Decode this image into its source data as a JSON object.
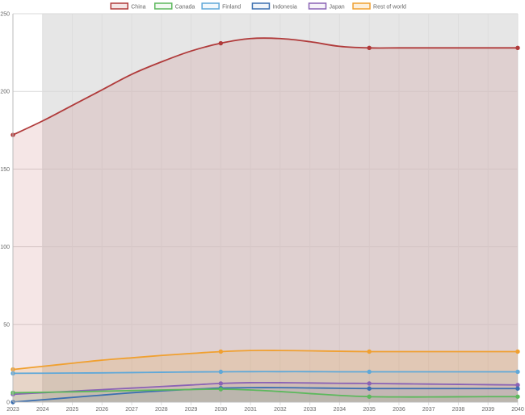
{
  "chart_data": {
    "type": "area",
    "title": "",
    "xlabel": "",
    "ylabel": "",
    "x": [
      "2023",
      "2024",
      "2025",
      "2026",
      "2027",
      "2028",
      "2029",
      "2030",
      "2031",
      "2032",
      "2033",
      "2034",
      "2035",
      "2036",
      "2037",
      "2038",
      "2039",
      "2040"
    ],
    "ylim": [
      0,
      250
    ],
    "y_ticks": [
      "0",
      "50",
      "100",
      "150",
      "200",
      "250"
    ],
    "grid": true,
    "legend_position": "top-center",
    "shaded_start_year": "2024",
    "series": [
      {
        "name": "China",
        "color": "#b03a3a",
        "fill": "rgba(176,58,58,0.13)",
        "anchor_x": [
          "2023",
          "2030",
          "2035",
          "2040"
        ],
        "values": [
          172,
          181,
          191,
          201,
          211,
          219,
          226,
          231,
          234,
          234,
          232,
          229,
          228,
          228,
          228,
          228,
          228,
          228
        ]
      },
      {
        "name": "Canada",
        "color": "#5cb85c",
        "fill": "rgba(92,184,92,0.08)",
        "anchor_x": [
          "2023",
          "2030",
          "2035",
          "2040"
        ],
        "values": [
          6,
          6.3,
          6.6,
          7,
          7.4,
          7.8,
          8.1,
          8.3,
          7.8,
          6.8,
          5.5,
          4.3,
          3.5,
          3.3,
          3.3,
          3.4,
          3.5,
          3.5
        ]
      },
      {
        "name": "Finland",
        "color": "#5fa8d8",
        "fill": "rgba(95,168,216,0.08)",
        "anchor_x": [
          "2023",
          "2030",
          "2035",
          "2040"
        ],
        "values": [
          18.5,
          18.6,
          18.7,
          18.8,
          19,
          19.2,
          19.4,
          19.5,
          19.6,
          19.6,
          19.6,
          19.5,
          19.5,
          19.5,
          19.5,
          19.5,
          19.5,
          19.5
        ]
      },
      {
        "name": "Indonesia",
        "color": "#3b6fb0",
        "fill": "rgba(59,111,176,0.08)",
        "anchor_x": [
          "2023",
          "2030",
          "2035",
          "2040"
        ],
        "values": [
          0,
          1.5,
          3,
          4.5,
          6,
          7.2,
          8.2,
          9,
          9.3,
          9.3,
          9.1,
          8.9,
          8.7,
          8.7,
          8.7,
          8.7,
          8.7,
          8.7
        ]
      },
      {
        "name": "Japan",
        "color": "#8a63b5",
        "fill": "rgba(138,99,181,0.08)",
        "anchor_x": [
          "2023",
          "2030",
          "2035",
          "2040"
        ],
        "values": [
          5,
          6,
          7,
          8,
          9,
          10,
          11,
          12,
          12.5,
          12.5,
          12.3,
          12.1,
          12,
          11.8,
          11.6,
          11.4,
          11.2,
          11
        ]
      },
      {
        "name": "Rest of world",
        "color": "#f0a030",
        "fill": "rgba(240,160,48,0.17)",
        "anchor_x": [
          "2023",
          "2030",
          "2035",
          "2040"
        ],
        "values": [
          21,
          23,
          25,
          27,
          28.5,
          30,
          31.3,
          32.5,
          33.2,
          33.2,
          33,
          32.7,
          32.5,
          32.5,
          32.5,
          32.5,
          32.5,
          32.5
        ]
      }
    ]
  }
}
